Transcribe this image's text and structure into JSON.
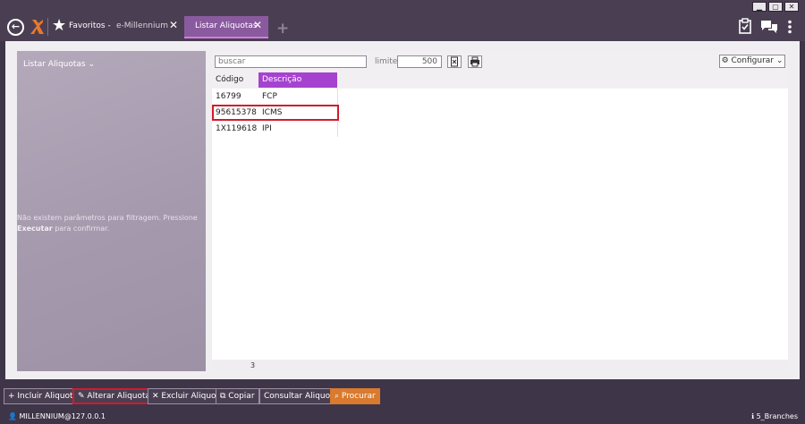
{
  "window_controls": [
    "▁",
    "▢",
    "✕"
  ],
  "tabs": {
    "favorites": "Favoritos -",
    "emillennium": "e-Millennium",
    "active": "Listar Aliquotas"
  },
  "left_panel": {
    "title": "Listar Aliquotas",
    "message_prefix": "Não existem parâmetros para filtragem. Pressione",
    "message_action": "Executar",
    "message_suffix": "para confirmar."
  },
  "toolbar": {
    "search_placeholder": "buscar",
    "limite_label": "limite:",
    "limite_value": "500",
    "configurar_label": "Configurar"
  },
  "table": {
    "columns": [
      "Código",
      "Descrição"
    ],
    "rows": [
      {
        "code": "16799",
        "desc": "FCP"
      },
      {
        "code": "95615378",
        "desc": "ICMS"
      },
      {
        "code": "1X119618",
        "desc": "IPI"
      }
    ],
    "count": "3"
  },
  "actions": {
    "incluir": "Incluir Aliquota",
    "alterar": "Alterar Aliquota",
    "excluir": "Excluir Aliquota",
    "copiar": "Copiar",
    "consultar": "Consultar Aliquota",
    "procurar": "Procurar"
  },
  "status": {
    "user": "MILLENNIUM@127.0.0.1",
    "branch": "5_Branches"
  },
  "colors": {
    "accent": "#a642d0",
    "highlight": "#d21b2b",
    "primary_button": "#d97a2e",
    "chrome": "#4a3f52"
  }
}
